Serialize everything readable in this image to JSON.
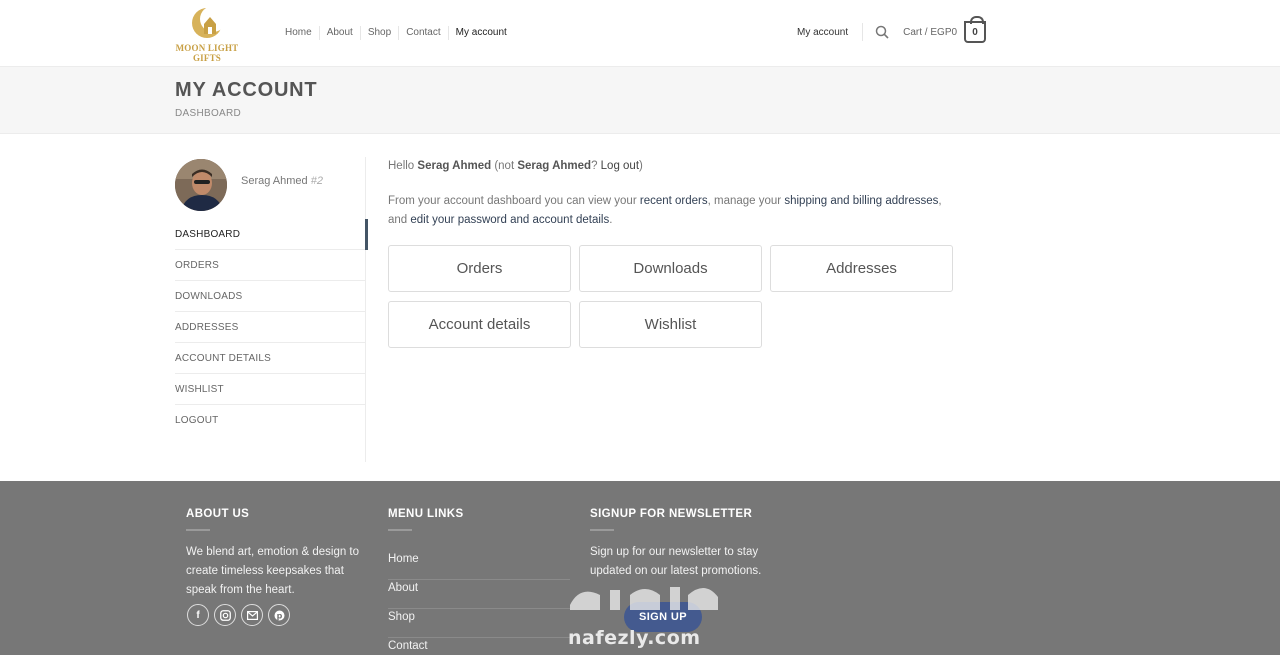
{
  "header": {
    "logo_text_line1": "MOON LIGHT",
    "logo_text_line2": "GIFTS",
    "nav": [
      {
        "label": "Home"
      },
      {
        "label": "About"
      },
      {
        "label": "Shop"
      },
      {
        "label": "Contact"
      },
      {
        "label": "My account"
      }
    ],
    "account_label": "My account",
    "cart_label": "Cart / EGP0",
    "cart_count": "0"
  },
  "page": {
    "title": "MY ACCOUNT",
    "subtitle": "DASHBOARD"
  },
  "sidebar": {
    "user_name": "Serag Ahmed",
    "user_id": "#2",
    "items": [
      {
        "label": "DASHBOARD"
      },
      {
        "label": "ORDERS"
      },
      {
        "label": "DOWNLOADS"
      },
      {
        "label": "ADDRESSES"
      },
      {
        "label": "ACCOUNT DETAILS"
      },
      {
        "label": "WISHLIST"
      },
      {
        "label": "LOGOUT"
      }
    ]
  },
  "main": {
    "hello_prefix": "Hello ",
    "hello_name": "Serag Ahmed",
    "hello_mid": " (not ",
    "hello_name2": "Serag Ahmed",
    "hello_q": "? ",
    "logout_link": "Log out",
    "hello_suffix": ")",
    "intro_1": "From your account dashboard you can view your ",
    "intro_link1": "recent orders",
    "intro_2": ", manage your ",
    "intro_link2": "shipping and billing addresses",
    "intro_3": ", and ",
    "intro_link3": "edit your password and account details",
    "intro_4": ".",
    "tiles": [
      {
        "label": "Orders"
      },
      {
        "label": "Downloads"
      },
      {
        "label": "Addresses"
      },
      {
        "label": "Account details"
      },
      {
        "label": "Wishlist"
      }
    ]
  },
  "footer": {
    "about_head": "ABOUT US",
    "about_text": "We blend art, emotion & design to create timeless keepsakes that speak from the heart.",
    "menu_head": "MENU LINKS",
    "menu_links": [
      {
        "label": "Home"
      },
      {
        "label": "About"
      },
      {
        "label": "Shop"
      },
      {
        "label": "Contact"
      }
    ],
    "news_head": "SIGNUP FOR NEWSLETTER",
    "news_text": "Sign up for our newsletter to stay updated on our latest promotions.",
    "signup_label": "SIGN UP",
    "social_icons": [
      "facebook-icon",
      "instagram-icon",
      "email-icon",
      "pinterest-icon"
    ],
    "watermark_text": "nafezly.com"
  }
}
